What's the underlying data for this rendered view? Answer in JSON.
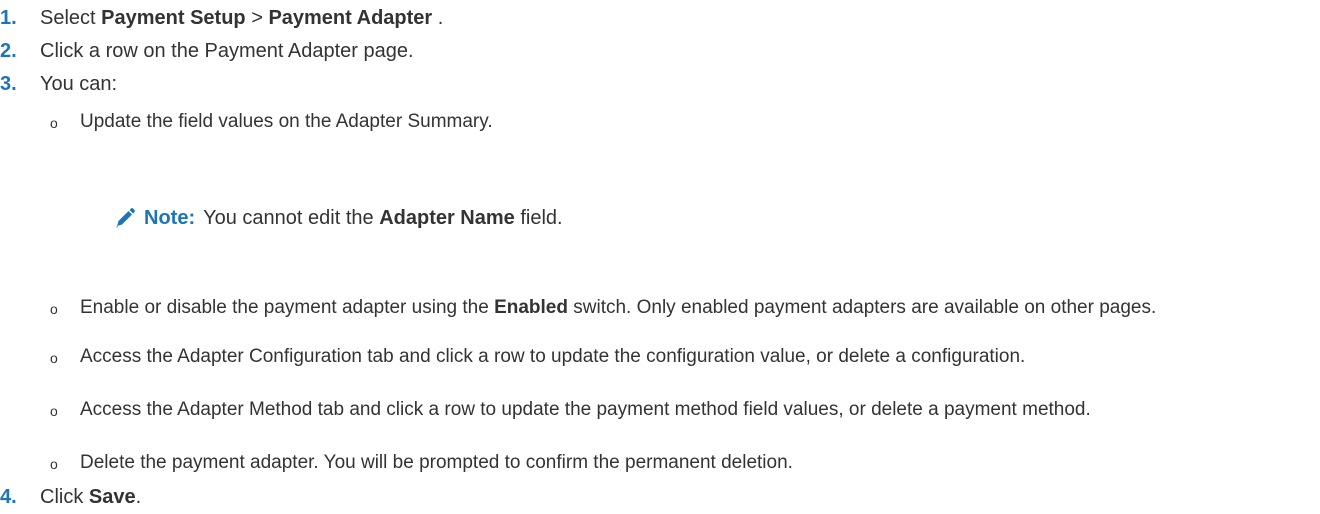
{
  "steps": [
    {
      "number": "1.",
      "pre": "Select ",
      "bold1": "Payment Setup",
      "mid": " > ",
      "bold2": "Payment Adapter",
      "post": " ."
    },
    {
      "number": "2.",
      "text": "Click a row on the Payment Adapter page."
    },
    {
      "number": "3.",
      "text": "You can:"
    },
    {
      "number": "4.",
      "pre": "Click ",
      "bold": "Save",
      "post": "."
    }
  ],
  "bullet_char": "o",
  "subitems": [
    {
      "text": "Update the field values on the Adapter Summary."
    },
    {
      "pre": "Enable or disable the payment adapter using the ",
      "bold": "Enabled",
      "post": " switch. Only enabled payment adapters are available on other pages."
    },
    {
      "text": "Access the Adapter Configuration tab and click a row to update the configuration value, or delete a configuration."
    },
    {
      "text": "Access the Adapter Method tab and click a row to update the payment method field values, or delete a payment method."
    },
    {
      "text": "Delete the payment adapter. You will be prompted to confirm the permanent deletion."
    }
  ],
  "note": {
    "label": "Note:",
    "pre": "You cannot edit the ",
    "bold": "Adapter Name",
    "post": " field.",
    "icon": "pencil-icon"
  },
  "colors": {
    "accent": "#1b75bb",
    "text": "#333333"
  }
}
